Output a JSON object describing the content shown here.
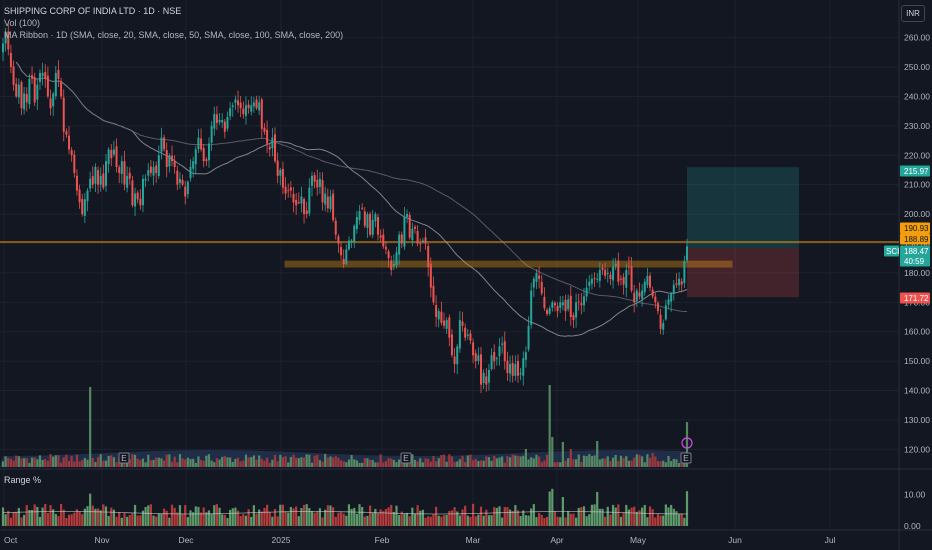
{
  "header": {
    "title": "SHIPPING CORP OF INDIA LTD · 1D · NSE",
    "volume": "Vol (100)",
    "ribbon": "MA Ribbon · 1D (SMA, close, 20, SMA, close, 50, SMA, close, 100, SMA, close, 200)"
  },
  "currency_button": "INR",
  "range_panel_label": "Range %",
  "colors": {
    "bg": "#131722",
    "up": "#26a69a",
    "down": "#ef5350",
    "up_vol": "#5f9a6a",
    "down_vol": "#b23b3b",
    "level": "#f59e0b",
    "ma_light": "#9aa0aa",
    "ma_dark": "#6b6b7b",
    "vol_area": "#2a3f6a"
  },
  "chart_data": {
    "type": "candlestick",
    "y_axis": {
      "ticks": [
        260,
        250,
        240,
        230,
        220,
        210,
        200,
        190,
        180,
        170,
        160,
        150,
        140,
        130,
        120
      ],
      "ylim": [
        114,
        266
      ]
    },
    "x_axis": {
      "labels": [
        "Oct",
        "Nov",
        "Dec",
        "2025",
        "Feb",
        "Mar",
        "Apr",
        "May",
        "Jun",
        "Jul"
      ]
    },
    "range_axis": {
      "ticks": [
        "10.00",
        "0.00"
      ]
    },
    "price_tags": [
      {
        "label": "215.97",
        "value": 215.97,
        "color": "#26a69a"
      },
      {
        "label": "190.93",
        "value": 190.93,
        "color": "#f59e0b"
      },
      {
        "label": "188.89",
        "value": 188.89,
        "color": "#f59e0b"
      },
      {
        "label": "188.47",
        "value": 188.47,
        "color": "#26a69a"
      },
      {
        "label": "40:59",
        "value": 185.3,
        "color": "#26a69a"
      },
      {
        "label": "171.72",
        "value": 171.72,
        "color": "#ef5350"
      }
    ],
    "symbol_tag": "SCI",
    "levels": [
      {
        "name": "horizontal line",
        "value": 190.5
      },
      {
        "name": "support zone",
        "from": 182,
        "to": 184
      }
    ],
    "position": {
      "entry": 188.47,
      "target": 215.97,
      "stop": 171.72,
      "start": "2025-05-16",
      "end": "2025-06-20"
    },
    "earnings_markers": [
      "E",
      "E",
      "E"
    ],
    "series": {
      "closes": [
        258,
        262,
        256,
        250,
        244,
        240,
        244,
        236,
        241,
        238,
        246,
        246,
        238,
        244,
        248,
        248,
        246,
        240,
        236,
        241,
        248,
        246,
        240,
        228,
        227,
        222,
        220,
        214,
        208,
        204,
        200,
        205,
        208,
        212,
        210,
        216,
        210,
        213,
        209,
        218,
        222,
        219,
        222,
        216,
        214,
        218,
        210,
        213,
        212,
        203,
        207,
        205,
        203,
        212,
        212,
        215,
        214,
        216,
        214,
        220,
        226,
        222,
        216,
        220,
        218,
        216,
        210,
        212,
        210,
        206,
        211,
        216,
        218,
        222,
        226,
        222,
        218,
        218,
        224,
        230,
        234,
        231,
        232,
        232,
        228,
        233,
        236,
        237,
        239,
        237,
        236,
        234,
        237,
        236,
        237,
        238,
        236,
        238,
        229,
        228,
        224,
        222,
        226,
        218,
        213,
        215,
        209,
        207,
        208,
        208,
        204,
        203,
        204,
        206,
        200,
        200,
        209,
        213,
        211,
        209,
        212,
        204,
        207,
        202,
        206,
        198,
        193,
        190,
        186,
        183,
        188,
        191,
        191,
        196,
        199,
        201,
        202,
        196,
        200,
        193,
        198,
        200,
        193,
        192,
        189,
        188,
        185,
        181,
        183,
        187,
        193,
        190,
        199,
        200,
        192,
        195,
        195,
        190,
        190,
        191,
        190,
        182,
        175,
        170,
        165,
        167,
        163,
        162,
        164,
        158,
        152,
        149,
        155,
        164,
        162,
        158,
        159,
        157,
        152,
        150,
        152,
        142,
        146,
        142,
        147,
        152,
        150,
        151,
        155,
        156,
        150,
        146,
        149,
        145,
        149,
        145,
        146,
        151,
        153,
        162,
        174,
        178,
        180,
        178,
        173,
        168,
        166,
        168,
        170,
        169,
        167,
        170,
        170,
        167,
        171,
        165,
        164,
        170,
        170,
        169,
        172,
        175,
        177,
        178,
        178,
        178,
        181,
        181,
        179,
        180,
        178,
        182,
        183,
        177,
        178,
        176,
        181,
        182,
        174,
        170,
        174,
        172,
        174,
        177,
        179,
        175,
        172,
        170,
        167,
        161,
        163,
        169,
        171,
        173,
        176,
        176,
        178,
        176,
        184,
        189
      ]
    },
    "notes": "Dates run from 1 Oct 2024 to 16 May 2025 (daily). Volume and range histogram bars and moving averages are drawn from the closes."
  }
}
